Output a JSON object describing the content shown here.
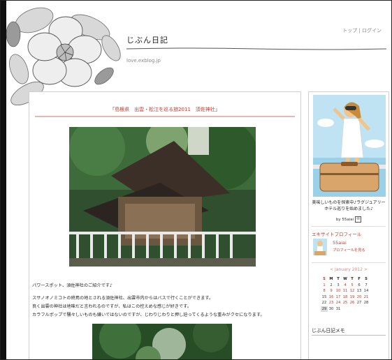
{
  "header": {
    "blog_title": "じぶん日記",
    "blog_url": "love.exblog.jp",
    "nav_top": "トップ",
    "nav_separator": " | ",
    "nav_login": "ログイン"
  },
  "post": {
    "title": "「島根県　出雲・松江を巡る旅2011　須佐神社」",
    "lines": [
      "パワースポット、須佐神社のご紹介です♪",
      "",
      "スサノオノミコトの終焉の地とされる須佐神社、出雲市内からはバスで行くことができます。",
      "良く出雲の神社は地味だと言われるのですが、私はこの控えめな感じが好きです。",
      "カラフルポップで騒々しいものも嫌いではないのですが、じわりじわりと押し迫ってくるような重みがクセになります。"
    ]
  },
  "sidebar": {
    "description": "美味しいものを探索中♪ラグジュアリーホテル巡りを始めました♪",
    "by_label": "by 55aiai",
    "profile_heading": "エキサイトプロフィール",
    "username": "55aiai",
    "profile_link": "プロフィールを見る",
    "calendar_title": "< January 2012 >",
    "calendar_headers": [
      "S",
      "M",
      "T",
      "W",
      "T",
      "F",
      "S"
    ],
    "calendar_rows": [
      [
        "1",
        "2",
        "3",
        "4",
        "5",
        "6",
        "7"
      ],
      [
        "8",
        "9",
        "10",
        "11",
        "12",
        "13",
        "14"
      ],
      [
        "15",
        "16",
        "17",
        "18",
        "19",
        "20",
        "21"
      ],
      [
        "22",
        "23",
        "24",
        "25",
        "26",
        "27",
        "28"
      ],
      [
        "29",
        "30",
        "31",
        "",
        "",
        "",
        ""
      ]
    ],
    "memo_heading": "じぶん日記メモ"
  },
  "colors": {
    "accent_red": "#c0392b",
    "calendar_title": "#d98880",
    "border": "#cfcfcf"
  }
}
